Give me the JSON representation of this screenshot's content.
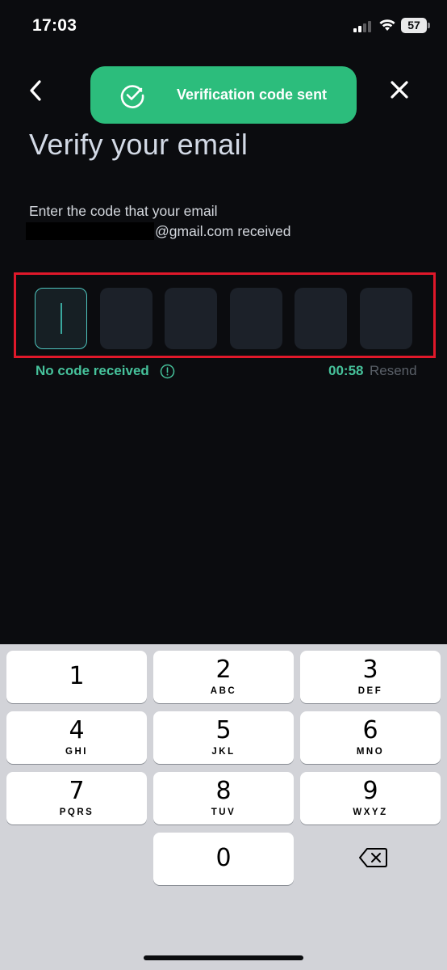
{
  "status_bar": {
    "time": "17:03",
    "battery": "57"
  },
  "toast": {
    "message": "Verification code sent",
    "color": "#2cbd7c"
  },
  "page": {
    "title": "Verify your email",
    "subtitle": "Enter the code that your email",
    "email_suffix": "@gmail.com received"
  },
  "otp": {
    "length": 6,
    "values": [
      "",
      "",
      "",
      "",
      "",
      ""
    ]
  },
  "no_code_label": "No code received",
  "timer": "00:58",
  "resend_label": "Resend",
  "keypad": {
    "keys": [
      {
        "num": "1",
        "letters": ""
      },
      {
        "num": "2",
        "letters": "ABC"
      },
      {
        "num": "3",
        "letters": "DEF"
      },
      {
        "num": "4",
        "letters": "GHI"
      },
      {
        "num": "5",
        "letters": "JKL"
      },
      {
        "num": "6",
        "letters": "MNO"
      },
      {
        "num": "7",
        "letters": "PQRS"
      },
      {
        "num": "8",
        "letters": "TUV"
      },
      {
        "num": "9",
        "letters": "WXYZ"
      },
      {
        "num": "0",
        "letters": ""
      }
    ]
  },
  "colors": {
    "accent": "#46c29b",
    "highlight": "#e0182a",
    "background": "#0b0c0f"
  }
}
